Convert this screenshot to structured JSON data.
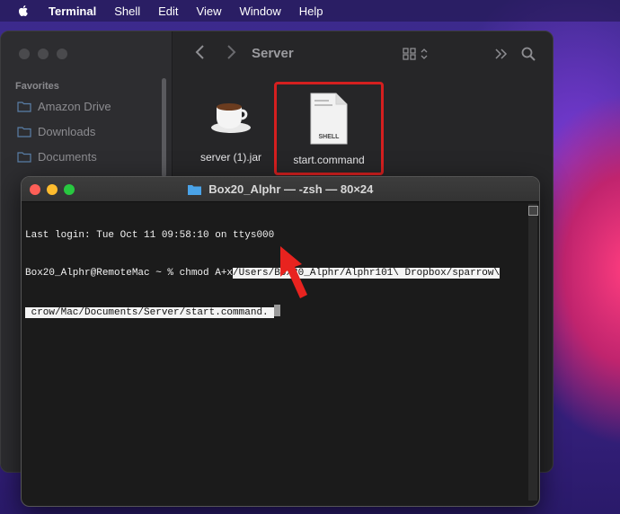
{
  "menubar": {
    "apple_icon": "apple-icon",
    "items": [
      "Terminal",
      "Shell",
      "Edit",
      "View",
      "Window",
      "Help"
    ]
  },
  "finder": {
    "title": "Server",
    "sidebar": {
      "section_title": "Favorites",
      "items": [
        "Amazon Drive",
        "Downloads",
        "Documents"
      ]
    },
    "files": [
      {
        "name": "server (1).jar",
        "icon": "java-cup-icon"
      },
      {
        "name": "start.command",
        "icon": "shell-document-icon",
        "badge": "SHELL",
        "highlighted": true
      }
    ],
    "highlight_color": "#d51f1f"
  },
  "terminal": {
    "title": "Box20_Alphr — -zsh — 80×24",
    "line1": "Last login: Tue Oct 11 09:58:10 on ttys000",
    "line2_prompt": "Box20_Alphr@RemoteMac ~ % chmod A+x",
    "line2_path": "/Users/Box20_Alphr/Alphr101\\ Dropbox/sparrow\\",
    "line3_path": " crow/Mac/Documents/Server/start.command. "
  },
  "annotation": {
    "arrow_color": "#e8231f"
  }
}
